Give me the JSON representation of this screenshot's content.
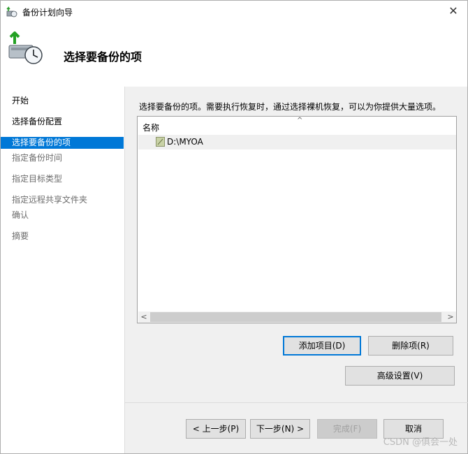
{
  "window": {
    "title": "备份计划向导",
    "close_label": "✕"
  },
  "header": {
    "title": "选择要备份的项"
  },
  "nav": {
    "items": [
      {
        "label": "开始"
      },
      {
        "label": "选择备份配置"
      },
      {
        "label": "选择要备份的项"
      },
      {
        "label": "指定备份时间"
      },
      {
        "label": "指定目标类型"
      },
      {
        "label": "指定远程共享文件夹"
      },
      {
        "label": "确认"
      },
      {
        "label": "摘要"
      }
    ],
    "selected_index": 2
  },
  "content": {
    "instruction": "选择要备份的项。需要执行恢复时，通过选择裸机恢复，可以为你提供大量选项。",
    "list": {
      "column_header": "名称",
      "sort_caret": "^",
      "items": [
        {
          "name": "D:\\MYOA"
        }
      ],
      "scroll_left": "<",
      "scroll_right": ">"
    },
    "buttons": {
      "add_item": "添加项目(D)",
      "remove_item": "删除项(R)",
      "advanced": "高级设置(V)"
    }
  },
  "footer": {
    "prev": "< 上一步(P)",
    "next": "下一步(N) >",
    "finish": "完成(F)",
    "cancel": "取消"
  },
  "watermark": "CSDN @俱会一处",
  "colors": {
    "accent": "#0078d7",
    "panel_bg": "#f0f0f0"
  }
}
